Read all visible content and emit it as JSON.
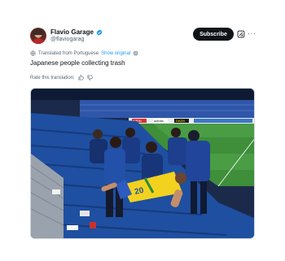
{
  "author": {
    "display_name": "Flavio Garage",
    "handle": "@flaviogarag"
  },
  "actions": {
    "subscribe_label": "Subscribe",
    "more_glyph": "···"
  },
  "translation": {
    "notice": "Translated from Portuguese",
    "show_original": "Show original"
  },
  "tweet": {
    "text": "Japanese people collecting trash"
  },
  "rating": {
    "prompt": "Rate this translation:"
  },
  "media": {
    "ad_boards": [
      "KIRIN",
      "adidas",
      "DAZN"
    ],
    "shirt_number": "20"
  },
  "colors": {
    "accent": "#1d9bf0",
    "text_primary": "#0f1419",
    "text_secondary": "#536471",
    "button_dark": "#0f1419"
  },
  "icons": [
    "verified-badge-icon",
    "grok-icon",
    "more-icon",
    "translate-icon",
    "settings-icon",
    "thumbs-up-icon",
    "thumbs-down-icon"
  ]
}
